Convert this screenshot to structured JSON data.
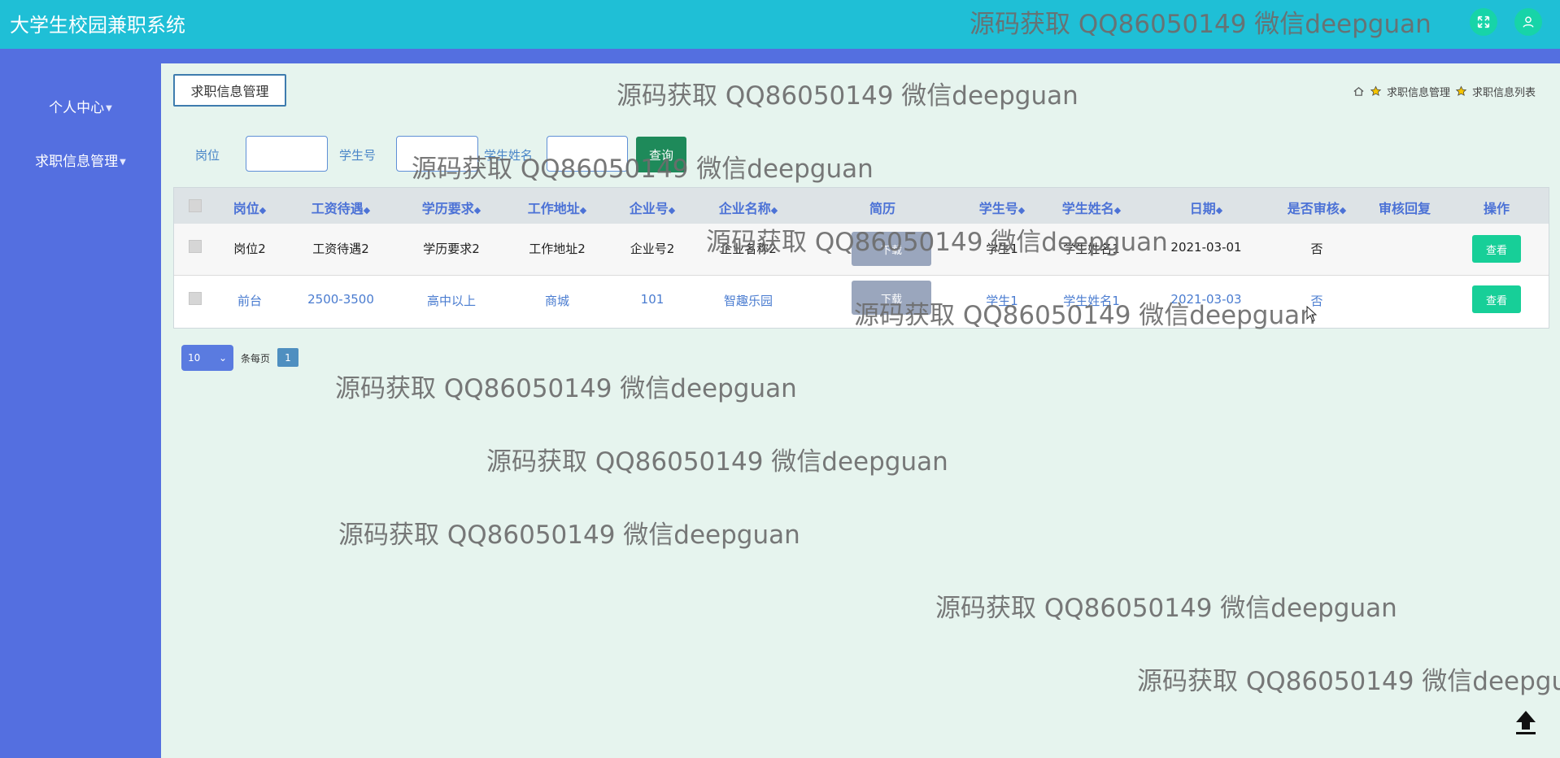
{
  "app": {
    "title": "大学生校园兼职系统"
  },
  "header": {
    "fullscreen_icon": "fullscreen-icon",
    "user_icon": "user-icon"
  },
  "sidebar": {
    "items": [
      {
        "label": "个人中心"
      },
      {
        "label": "求职信息管理"
      }
    ]
  },
  "page": {
    "tag_label": "求职信息管理"
  },
  "breadcrumb": {
    "items": [
      "求职信息管理",
      "求职信息列表"
    ]
  },
  "search": {
    "fields": [
      {
        "label": "岗位",
        "value": ""
      },
      {
        "label": "学生号",
        "value": ""
      },
      {
        "label": "学生姓名",
        "value": ""
      }
    ],
    "query_label": "查询"
  },
  "table": {
    "columns": [
      "岗位",
      "工资待遇",
      "学历要求",
      "工作地址",
      "企业号",
      "企业名称",
      "简历",
      "学生号",
      "学生姓名",
      "日期",
      "是否审核",
      "审核回复",
      "操作"
    ],
    "rows": [
      {
        "post": "岗位2",
        "salary": "工资待遇2",
        "education": "学历要求2",
        "address": "工作地址2",
        "company_no": "企业号2",
        "company_name": "企业名称2",
        "resume": "下载",
        "student_no": "学生1",
        "student_name": "学生姓名1",
        "date": "2021-03-01",
        "reviewed": "否",
        "reply": "",
        "action": "查看"
      },
      {
        "post": "前台",
        "salary": "2500-3500",
        "education": "高中以上",
        "address": "商城",
        "company_no": "101",
        "company_name": "智趣乐园",
        "resume": "下载",
        "student_no": "学生1",
        "student_name": "学生姓名1",
        "date": "2021-03-03",
        "reviewed": "否",
        "reply": "",
        "action": "查看"
      }
    ]
  },
  "pagination": {
    "page_size": "10",
    "per_page_label": "条每页",
    "current_page": "1"
  },
  "watermark": {
    "text": "源码获取 QQ86050149 微信deepguan"
  },
  "colors": {
    "topbar": "#1fbfd6",
    "sidebar": "#546fe0",
    "content_bg": "#e6f4ee",
    "accent_green": "#17cf98"
  }
}
